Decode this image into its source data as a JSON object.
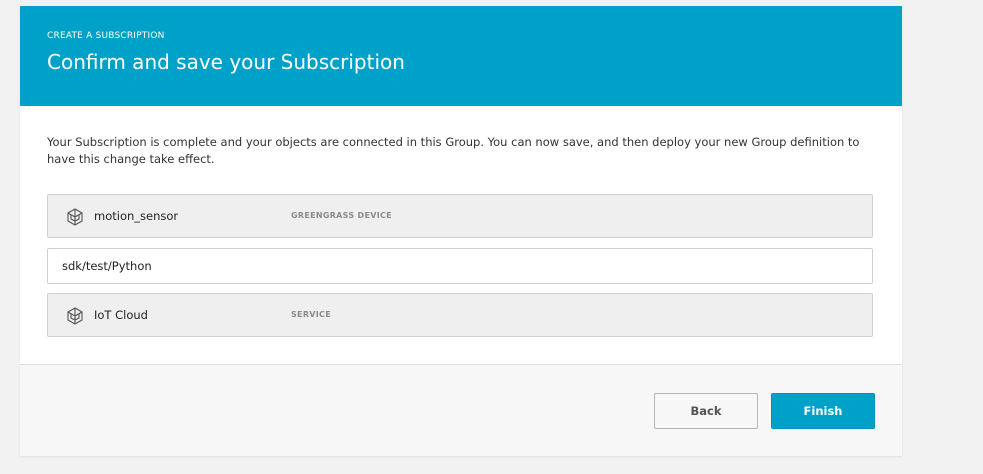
{
  "header": {
    "eyebrow": "CREATE A SUBSCRIPTION",
    "title": "Confirm and save your Subscription"
  },
  "body": {
    "description": "Your Subscription is complete and your objects are connected in this Group. You can now save, and then deploy your new Group definition to have this change take effect.",
    "source": {
      "name": "motion_sensor",
      "type": "GREENGRASS DEVICE",
      "icon": "iot-thing-icon"
    },
    "topic": "sdk/test/Python",
    "target": {
      "name": "IoT Cloud",
      "type": "SERVICE",
      "icon": "iot-thing-icon"
    }
  },
  "footer": {
    "back_label": "Back",
    "finish_label": "Finish"
  },
  "colors": {
    "accent": "#00a1c9",
    "page_background": "#f2f2f2"
  }
}
